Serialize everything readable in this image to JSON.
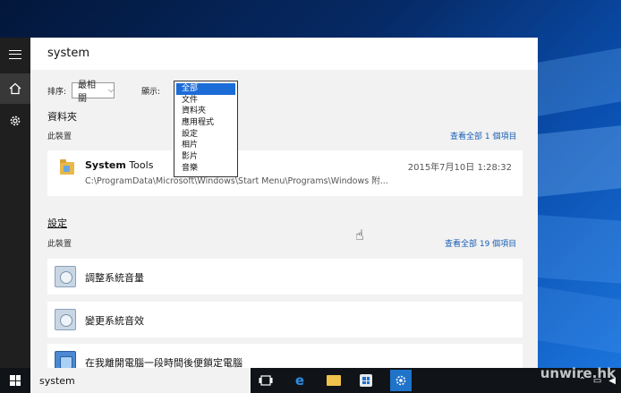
{
  "search": {
    "query": "system"
  },
  "filters": {
    "sort_label": "排序:",
    "sort_value": "最相關",
    "show_label": "顯示:",
    "options": [
      "全部",
      "文件",
      "資料夾",
      "應用程式",
      "設定",
      "相片",
      "影片",
      "音樂"
    ]
  },
  "folders": {
    "title": "資料夾",
    "sub": "此裝置",
    "see_all": "查看全部 1 個項目",
    "item": {
      "title_bold": "System",
      "title_rest": " Tools",
      "path": "C:\\ProgramData\\Microsoft\\Windows\\Start Menu\\Programs\\Windows 附...",
      "date": "2015年7月10日 1:28:32"
    }
  },
  "settings": {
    "title": "設定",
    "sub": "此裝置",
    "see_all": "查看全部 19 個項目",
    "items": [
      "調整系統音量",
      "變更系統音效",
      "在我離開電腦一段時間後便鎖定電腦"
    ]
  },
  "taskbar": {
    "search_text": "system"
  },
  "watermark": "unwire.hk",
  "colors": {
    "accent": "#1c6cd8",
    "link": "#1a5fb4",
    "taskbar": "#101418",
    "rail": "#1f1f1f"
  }
}
